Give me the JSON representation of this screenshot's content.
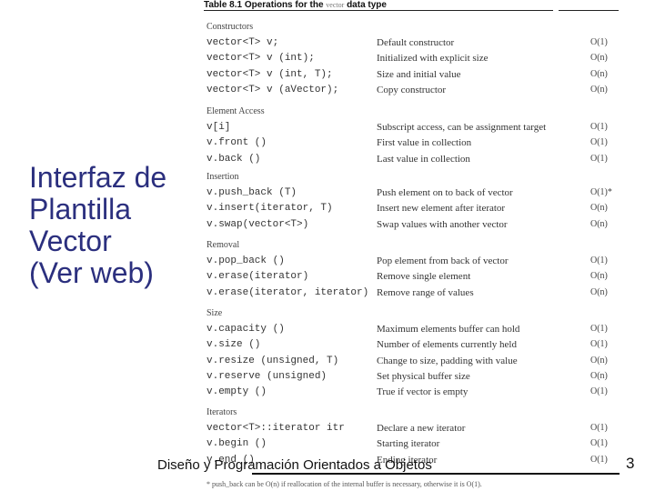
{
  "slide": {
    "title_lines": [
      "Interfaz de",
      "Plantilla",
      "Vector",
      "(Ver web)"
    ],
    "title_color": "#2b2f7e",
    "footer": "Diseño y Programación Orientados a Objetos",
    "page_number": "3"
  },
  "table": {
    "caption_prefix": "Table 8.1   Operations for the ",
    "caption_code": "vector",
    "caption_suffix": " data type",
    "sections": [
      {
        "label": "Constructors",
        "rows": [
          {
            "op": "vector<T> v;",
            "desc": "Default constructor",
            "complexity": "O(1)"
          },
          {
            "op": "vector<T> v (int);",
            "desc": "Initialized with explicit size",
            "complexity": "O(n)"
          },
          {
            "op": "vector<T> v (int, T);",
            "desc": "Size and initial value",
            "complexity": "O(n)"
          },
          {
            "op": "vector<T> v (aVector);",
            "desc": "Copy constructor",
            "complexity": "O(n)"
          }
        ]
      },
      {
        "label": "Element Access",
        "rows": [
          {
            "op": "v[i]",
            "desc": "Subscript access, can be assignment target",
            "complexity": "O(1)"
          },
          {
            "op": "v.front ()",
            "desc": "First value in collection",
            "complexity": "O(1)"
          },
          {
            "op": "v.back ()",
            "desc": "Last value in collection",
            "complexity": "O(1)"
          }
        ]
      },
      {
        "label": "Insertion",
        "rows": [
          {
            "op": "v.push_back (T)",
            "desc": "Push element on to back of vector",
            "complexity": "O(1)*"
          },
          {
            "op": "v.insert(iterator, T)",
            "desc": "Insert new element after iterator",
            "complexity": "O(n)"
          },
          {
            "op": "v.swap(vector<T>)",
            "desc": "Swap values with another vector",
            "complexity": "O(n)"
          }
        ]
      },
      {
        "label": "Removal",
        "rows": [
          {
            "op": "v.pop_back ()",
            "desc": "Pop element from back of vector",
            "complexity": "O(1)"
          },
          {
            "op": "v.erase(iterator)",
            "desc": "Remove single element",
            "complexity": "O(n)"
          },
          {
            "op": "v.erase(iterator, iterator)",
            "desc": "Remove range of values",
            "complexity": "O(n)"
          }
        ]
      },
      {
        "label": "Size",
        "rows": [
          {
            "op": "v.capacity ()",
            "desc": "Maximum elements buffer can hold",
            "complexity": "O(1)"
          },
          {
            "op": "v.size ()",
            "desc": "Number of elements currently held",
            "complexity": "O(1)"
          },
          {
            "op": "v.resize (unsigned, T)",
            "desc": "Change to size, padding with value",
            "complexity": "O(n)"
          },
          {
            "op": "v.reserve (unsigned)",
            "desc": "Set physical buffer size",
            "complexity": "O(n)"
          },
          {
            "op": "v.empty ()",
            "desc": "True if vector is empty",
            "complexity": "O(1)"
          }
        ]
      },
      {
        "label": "Iterators",
        "rows": [
          {
            "op": "vector<T>::iterator itr",
            "desc": "Declare a new iterator",
            "complexity": "O(1)"
          },
          {
            "op": "v.begin ()",
            "desc": "Starting iterator",
            "complexity": "O(1)"
          },
          {
            "op": "v.end ()",
            "desc": "Ending iterator",
            "complexity": "O(1)"
          }
        ]
      }
    ],
    "footnote": "* push_back can be O(n) if reallocation of the internal buffer is necessary, otherwise it is O(1)."
  }
}
